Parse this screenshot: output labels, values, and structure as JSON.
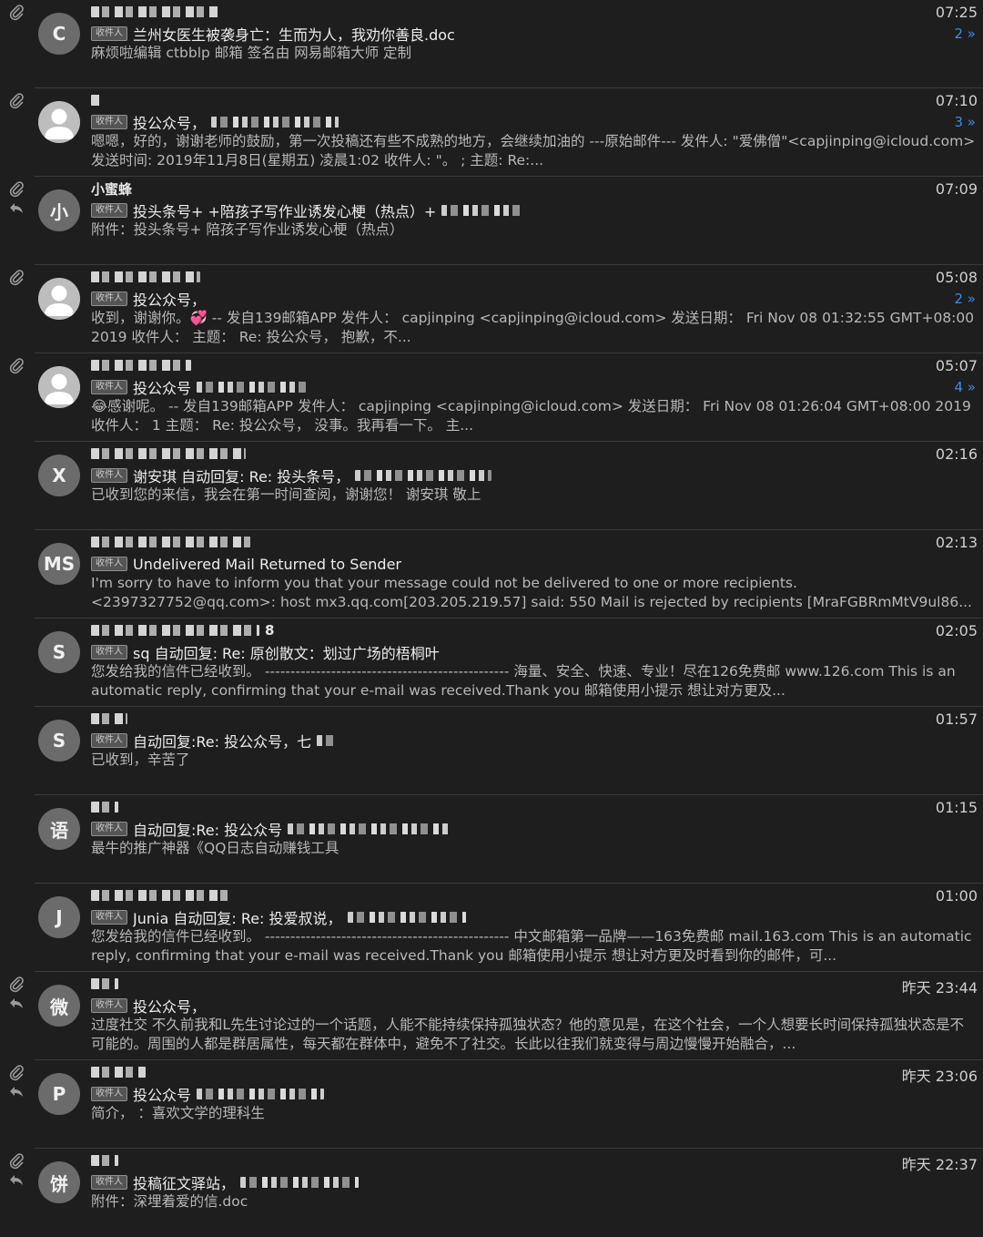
{
  "tag_label": "收件人",
  "emails": [
    {
      "avatar": "C",
      "avatar_kind": "letter",
      "has_attachment": true,
      "replied": false,
      "sender": "",
      "time": "07:25",
      "thread_count": "2 »",
      "subject": "兰州女医生被袭身亡：生而为人，我劝你善良.doc",
      "preview": "麻烦啦编辑 ctbblp 邮箱 签名由 网易邮箱大师 定制"
    },
    {
      "avatar": "",
      "avatar_kind": "person",
      "has_attachment": true,
      "replied": false,
      "sender": "",
      "time": "07:10",
      "thread_count": "3 »",
      "subject": "投公众号，",
      "preview": "嗯嗯，好的，谢谢老师的鼓励，第一次投稿还有些不成熟的地方，会继续加油的 ---原始邮件--- 发件人: \"爱佛僧\"<capjinping@icloud.com> 发送时间: 2019年11月8日(星期五) 凌晨1:02 收件人: \"。 ; 主题: Re:..."
    },
    {
      "avatar": "小",
      "avatar_kind": "letter",
      "has_attachment": true,
      "replied": true,
      "sender": "小蜜蜂",
      "time": "07:09",
      "thread_count": "",
      "subject": "投头条号+ +陪孩子写作业诱发心梗（热点）+",
      "preview": "附件：投头条号+ 陪孩子写作业诱发心梗（热点）"
    },
    {
      "avatar": "",
      "avatar_kind": "person",
      "has_attachment": true,
      "replied": false,
      "sender": "",
      "time": "05:08",
      "thread_count": "2 »",
      "subject": "投公众号，",
      "preview": "收到，谢谢你。💞 -- 发自139邮箱APP 发件人： capjinping <capjinping@icloud.com> 发送日期： Fri Nov 08 01:32:55 GMT+08:00 2019 收件人： 主题： Re: 投公众号， 抱歉，不..."
    },
    {
      "avatar": "",
      "avatar_kind": "person",
      "has_attachment": true,
      "replied": false,
      "sender": "",
      "time": "05:07",
      "thread_count": "4 »",
      "subject": "投公众号",
      "preview": "😂感谢呢。 -- 发自139邮箱APP 发件人： capjinping <capjinping@icloud.com> 发送日期： Fri Nov 08 01:26:04 GMT+08:00 2019 收件人： 1 主题： Re: 投公众号， 没事。我再看一下。 主..."
    },
    {
      "avatar": "X",
      "avatar_kind": "letter",
      "has_attachment": false,
      "replied": false,
      "sender": "",
      "time": "02:16",
      "thread_count": "",
      "subject": "谢安琪 自动回复: Re: 投头条号，",
      "preview": "已收到您的来信，我会在第一时间查阅，谢谢您！ 谢安琪 敬上"
    },
    {
      "avatar": "MS",
      "avatar_kind": "letter",
      "has_attachment": false,
      "replied": false,
      "sender": "",
      "time": "02:13",
      "thread_count": "",
      "subject": "Undelivered Mail Returned to Sender",
      "preview": "I'm sorry to have to inform you that your message could not be delivered to one or more recipients. <2397327752@qq.com>: host mx3.qq.com[203.205.219.57] said: 550 Mail is rejected by recipients [MraFGBRmMtV9ul86..."
    },
    {
      "avatar": "S",
      "avatar_kind": "letter",
      "has_attachment": false,
      "replied": false,
      "sender": "8",
      "time": "02:05",
      "thread_count": "",
      "subject": "sq 自动回复: Re: 原创散文：划过广场的梧桐叶",
      "preview": "您发给我的信件已经收到。 ------------------------------------------------ 海量、安全、快速、专业！尽在126免费邮 www.126.com This is an automatic reply, confirming that your e-mail was received.Thank you 邮箱使用小提示 想让对方更及..."
    },
    {
      "avatar": "S",
      "avatar_kind": "letter",
      "has_attachment": false,
      "replied": false,
      "sender": "",
      "time": "01:57",
      "thread_count": "",
      "subject": "自动回复:Re: 投公众号，七",
      "preview": "已收到，辛苦了"
    },
    {
      "avatar": "语",
      "avatar_kind": "letter",
      "has_attachment": false,
      "replied": false,
      "sender": "",
      "time": "01:15",
      "thread_count": "",
      "subject": "自动回复:Re: 投公众号",
      "preview": "最牛的推广神器《QQ日志自动赚钱工具"
    },
    {
      "avatar": "J",
      "avatar_kind": "letter",
      "has_attachment": false,
      "replied": false,
      "sender": "",
      "time": "01:00",
      "thread_count": "",
      "subject": "Junia 自动回复: Re: 投爱叔说，",
      "preview": "您发给我的信件已经收到。 ------------------------------------------------ 中文邮箱第一品牌——163免费邮 mail.163.com This is an automatic reply, confirming that your e-mail was received.Thank you 邮箱使用小提示 想让对方更及时看到你的邮件，可..."
    },
    {
      "avatar": "微",
      "avatar_kind": "letter",
      "has_attachment": true,
      "replied": true,
      "sender": "",
      "time": "昨天 23:44",
      "thread_count": "",
      "subject": "投公众号，",
      "preview": "过度社交 不久前我和L先生讨论过的一个话题，人能不能持续保持孤独状态？他的意见是，在这个社会，一个人想要长时间保持孤独状态是不可能的。周围的人都是群居属性，每天都在群体中，避免不了社交。长此以往我们就变得与周边慢慢开始融合，..."
    },
    {
      "avatar": "P",
      "avatar_kind": "letter",
      "has_attachment": true,
      "replied": true,
      "sender": "",
      "time": "昨天 23:06",
      "thread_count": "",
      "subject": "投公众号",
      "preview": "简介， ：喜欢文学的理科生"
    },
    {
      "avatar": "饼",
      "avatar_kind": "letter",
      "has_attachment": true,
      "replied": true,
      "sender": "",
      "time": "昨天 22:37",
      "thread_count": "",
      "subject": "投稿征文驿站，",
      "preview": "附件：深埋着爱的信.doc"
    }
  ]
}
